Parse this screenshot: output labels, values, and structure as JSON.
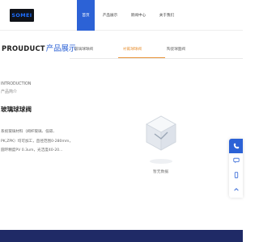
{
  "header": {
    "logo_text": "SOMEI",
    "nav": [
      {
        "label": "首页",
        "active": true
      },
      {
        "label": "产品展示",
        "active": false
      },
      {
        "label": "新闻中心",
        "active": false
      },
      {
        "label": "关于我们",
        "active": false
      }
    ]
  },
  "section": {
    "title_en": "PROUDUCT",
    "title_cn": "产品展示"
  },
  "tabs": [
    {
      "label": "玻璃球球阀",
      "active": false
    },
    {
      "label": "衬氟球球阀",
      "active": true
    },
    {
      "label": "陶瓷球面阀",
      "active": false
    }
  ],
  "intro": {
    "label_en": "INTRODUCTION",
    "label_cn": "产品简介",
    "product_name": "玻璃球球阀",
    "description_lines": [
      "系统玻璃材料（阀杆玻璃、低碳、",
      "PK,ZPK）均可加工，直径范围0-280mm，",
      "圆环精度PV 0.3um，光洁度40-20..."
    ]
  },
  "empty_state": {
    "icon": "empty-box-icon",
    "text": "暂无数据"
  },
  "side_tools": [
    {
      "icon": "phone-icon",
      "active": true
    },
    {
      "icon": "chat-icon",
      "active": false
    },
    {
      "icon": "mobile-icon",
      "active": false
    },
    {
      "icon": "back-to-top-icon",
      "active": false
    }
  ],
  "colors": {
    "accent": "#2c62d6",
    "tab_active": "#e8943a",
    "footer": "#1f2a66",
    "logo_bg": "#0f1218"
  }
}
